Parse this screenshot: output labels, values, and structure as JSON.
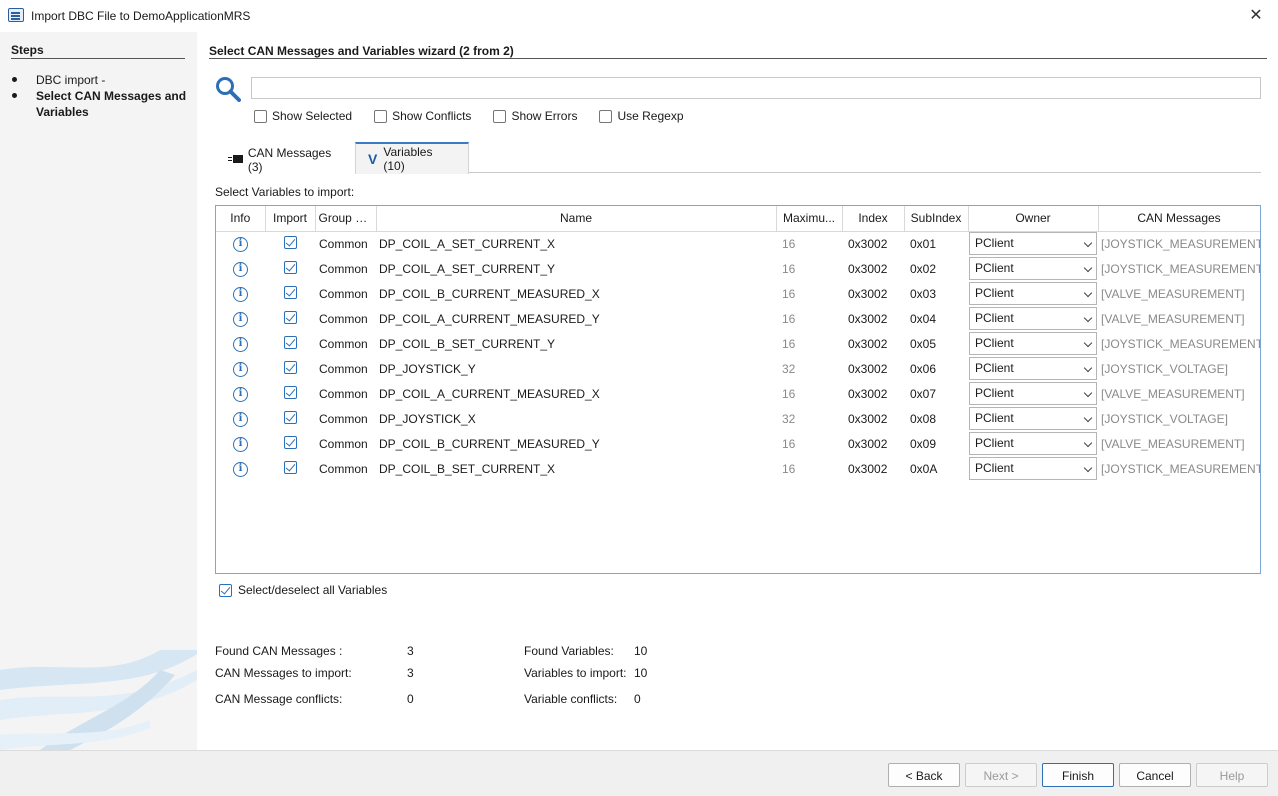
{
  "window": {
    "title": "Import DBC File to DemoApplicationMRS",
    "close_glyph": "✕"
  },
  "steps": {
    "title": "Steps",
    "items": [
      {
        "label": "DBC import -",
        "active": false
      },
      {
        "label": "Select CAN Messages and Variables",
        "active": true
      }
    ]
  },
  "wizard": {
    "title": "Select CAN Messages and Variables wizard (2 from 2)"
  },
  "search": {
    "value": "",
    "placeholder": "",
    "icon": "search-icon"
  },
  "filters": [
    {
      "label": "Show Selected",
      "checked": false
    },
    {
      "label": "Show Conflicts",
      "checked": false
    },
    {
      "label": "Show Errors",
      "checked": false
    },
    {
      "label": "Use Regexp",
      "checked": false
    }
  ],
  "tabs": [
    {
      "label": "CAN Messages (3)",
      "icon": "message-icon",
      "active": false
    },
    {
      "label": "Variables (10)",
      "icon": "variable-v-icon",
      "active": true
    }
  ],
  "section_label": "Select Variables to import:",
  "table": {
    "columns": [
      "Info",
      "Import",
      "Group N...",
      "Name",
      "Maximu...",
      "Index",
      "SubIndex",
      "Owner",
      "CAN Messages"
    ],
    "rows": [
      {
        "checked": true,
        "group": "Common",
        "name": "DP_COIL_A_SET_CURRENT_X",
        "max": "16",
        "index": "0x3002",
        "subindex": "0x01",
        "owner": "PClient",
        "can": "[JOYSTICK_MEASUREMENT]"
      },
      {
        "checked": true,
        "group": "Common",
        "name": "DP_COIL_A_SET_CURRENT_Y",
        "max": "16",
        "index": "0x3002",
        "subindex": "0x02",
        "owner": "PClient",
        "can": "[JOYSTICK_MEASUREMENT]"
      },
      {
        "checked": true,
        "group": "Common",
        "name": "DP_COIL_B_CURRENT_MEASURED_X",
        "max": "16",
        "index": "0x3002",
        "subindex": "0x03",
        "owner": "PClient",
        "can": "[VALVE_MEASUREMENT]"
      },
      {
        "checked": true,
        "group": "Common",
        "name": "DP_COIL_A_CURRENT_MEASURED_Y",
        "max": "16",
        "index": "0x3002",
        "subindex": "0x04",
        "owner": "PClient",
        "can": "[VALVE_MEASUREMENT]"
      },
      {
        "checked": true,
        "group": "Common",
        "name": "DP_COIL_B_SET_CURRENT_Y",
        "max": "16",
        "index": "0x3002",
        "subindex": "0x05",
        "owner": "PClient",
        "can": "[JOYSTICK_MEASUREMENT]"
      },
      {
        "checked": true,
        "group": "Common",
        "name": "DP_JOYSTICK_Y",
        "max": "32",
        "index": "0x3002",
        "subindex": "0x06",
        "owner": "PClient",
        "can": "[JOYSTICK_VOLTAGE]"
      },
      {
        "checked": true,
        "group": "Common",
        "name": "DP_COIL_A_CURRENT_MEASURED_X",
        "max": "16",
        "index": "0x3002",
        "subindex": "0x07",
        "owner": "PClient",
        "can": "[VALVE_MEASUREMENT]"
      },
      {
        "checked": true,
        "group": "Common",
        "name": "DP_JOYSTICK_X",
        "max": "32",
        "index": "0x3002",
        "subindex": "0x08",
        "owner": "PClient",
        "can": "[JOYSTICK_VOLTAGE]"
      },
      {
        "checked": true,
        "group": "Common",
        "name": "DP_COIL_B_CURRENT_MEASURED_Y",
        "max": "16",
        "index": "0x3002",
        "subindex": "0x09",
        "owner": "PClient",
        "can": "[VALVE_MEASUREMENT]"
      },
      {
        "checked": true,
        "group": "Common",
        "name": "DP_COIL_B_SET_CURRENT_X",
        "max": "16",
        "index": "0x3002",
        "subindex": "0x0A",
        "owner": "PClient",
        "can": "[JOYSTICK_MEASUREMENT]"
      }
    ]
  },
  "select_all": {
    "label": "Select/deselect all Variables",
    "checked": true
  },
  "stats": {
    "found_can_label": "Found CAN Messages :",
    "found_can_value": "3",
    "can_import_label": "CAN Messages to import:",
    "can_import_value": "3",
    "can_conflicts_label": "CAN Message conflicts:",
    "can_conflicts_value": "0",
    "found_vars_label": "Found Variables:",
    "found_vars_value": "10",
    "vars_import_label": "Variables to import:",
    "vars_import_value": "10",
    "var_conflicts_label": "Variable conflicts:",
    "var_conflicts_value": "0"
  },
  "buttons": {
    "back": "< Back",
    "next": "Next >",
    "finish": "Finish",
    "cancel": "Cancel",
    "help": "Help"
  },
  "colors": {
    "accent": "#2d6fb6",
    "muted_text": "#8a8a8a"
  }
}
